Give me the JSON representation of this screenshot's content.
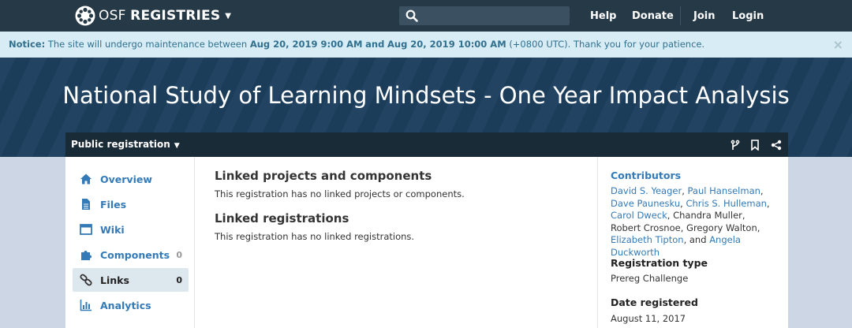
{
  "navbar": {
    "brand_prefix": "OSF",
    "brand_name": "REGISTRIES",
    "search_placeholder": "",
    "links": [
      "Help",
      "Donate",
      "Join",
      "Login"
    ]
  },
  "notice": {
    "label": "Notice:",
    "text_before": "The site will undergo maintenance between",
    "start": "Aug 20, 2019 9:00 AM",
    "and": "and",
    "end": "Aug 20, 2019 10:00 AM",
    "text_after": "(+0800 UTC). Thank you for your patience.",
    "close": "×"
  },
  "hero": {
    "title": "National Study of Learning Mindsets - One Year Impact Analysis"
  },
  "toolbar": {
    "label": "Public registration",
    "icons": [
      "fork-icon",
      "bookmark-icon",
      "share-icon"
    ]
  },
  "sidebar": {
    "items": [
      {
        "label": "Overview",
        "icon": "home-icon",
        "count": ""
      },
      {
        "label": "Files",
        "icon": "file-icon",
        "count": ""
      },
      {
        "label": "Wiki",
        "icon": "wiki-icon",
        "count": ""
      },
      {
        "label": "Components",
        "icon": "puzzle-icon",
        "count": "0"
      },
      {
        "label": "Links",
        "icon": "link-icon",
        "count": "0"
      },
      {
        "label": "Analytics",
        "icon": "analytics-icon",
        "count": ""
      }
    ],
    "active": "Links"
  },
  "main": {
    "linked_projects_title": "Linked projects and components",
    "linked_projects_text": "This registration has no linked projects or components.",
    "linked_registrations_title": "Linked registrations",
    "linked_registrations_text": "This registration has no linked registrations."
  },
  "aside": {
    "contributors_title": "Contributors",
    "contributors": [
      {
        "name": "David S. Yeager",
        "link": true
      },
      {
        "name": "Paul Hanselman",
        "link": true
      },
      {
        "name": "Dave Paunesku",
        "link": true
      },
      {
        "name": "Chris S. Hulleman",
        "link": true
      },
      {
        "name": "Carol Dweck",
        "link": true
      },
      {
        "name": "Chandra Muller",
        "link": false
      },
      {
        "name": "Robert Crosnoe",
        "link": false
      },
      {
        "name": "Gregory Walton",
        "link": false
      },
      {
        "name": "Elizabeth Tipton",
        "link": true
      },
      {
        "name": "Angela Duckworth",
        "link": true
      }
    ],
    "registration_type_title": "Registration type",
    "registration_type": "Prereg Challenge",
    "date_registered_title": "Date registered",
    "date_registered": "August 11, 2017"
  },
  "colors": {
    "navbar": "#263947",
    "hero": "#1d3f5e",
    "link": "#337ab7",
    "notice_bg": "#d7ecf4"
  }
}
